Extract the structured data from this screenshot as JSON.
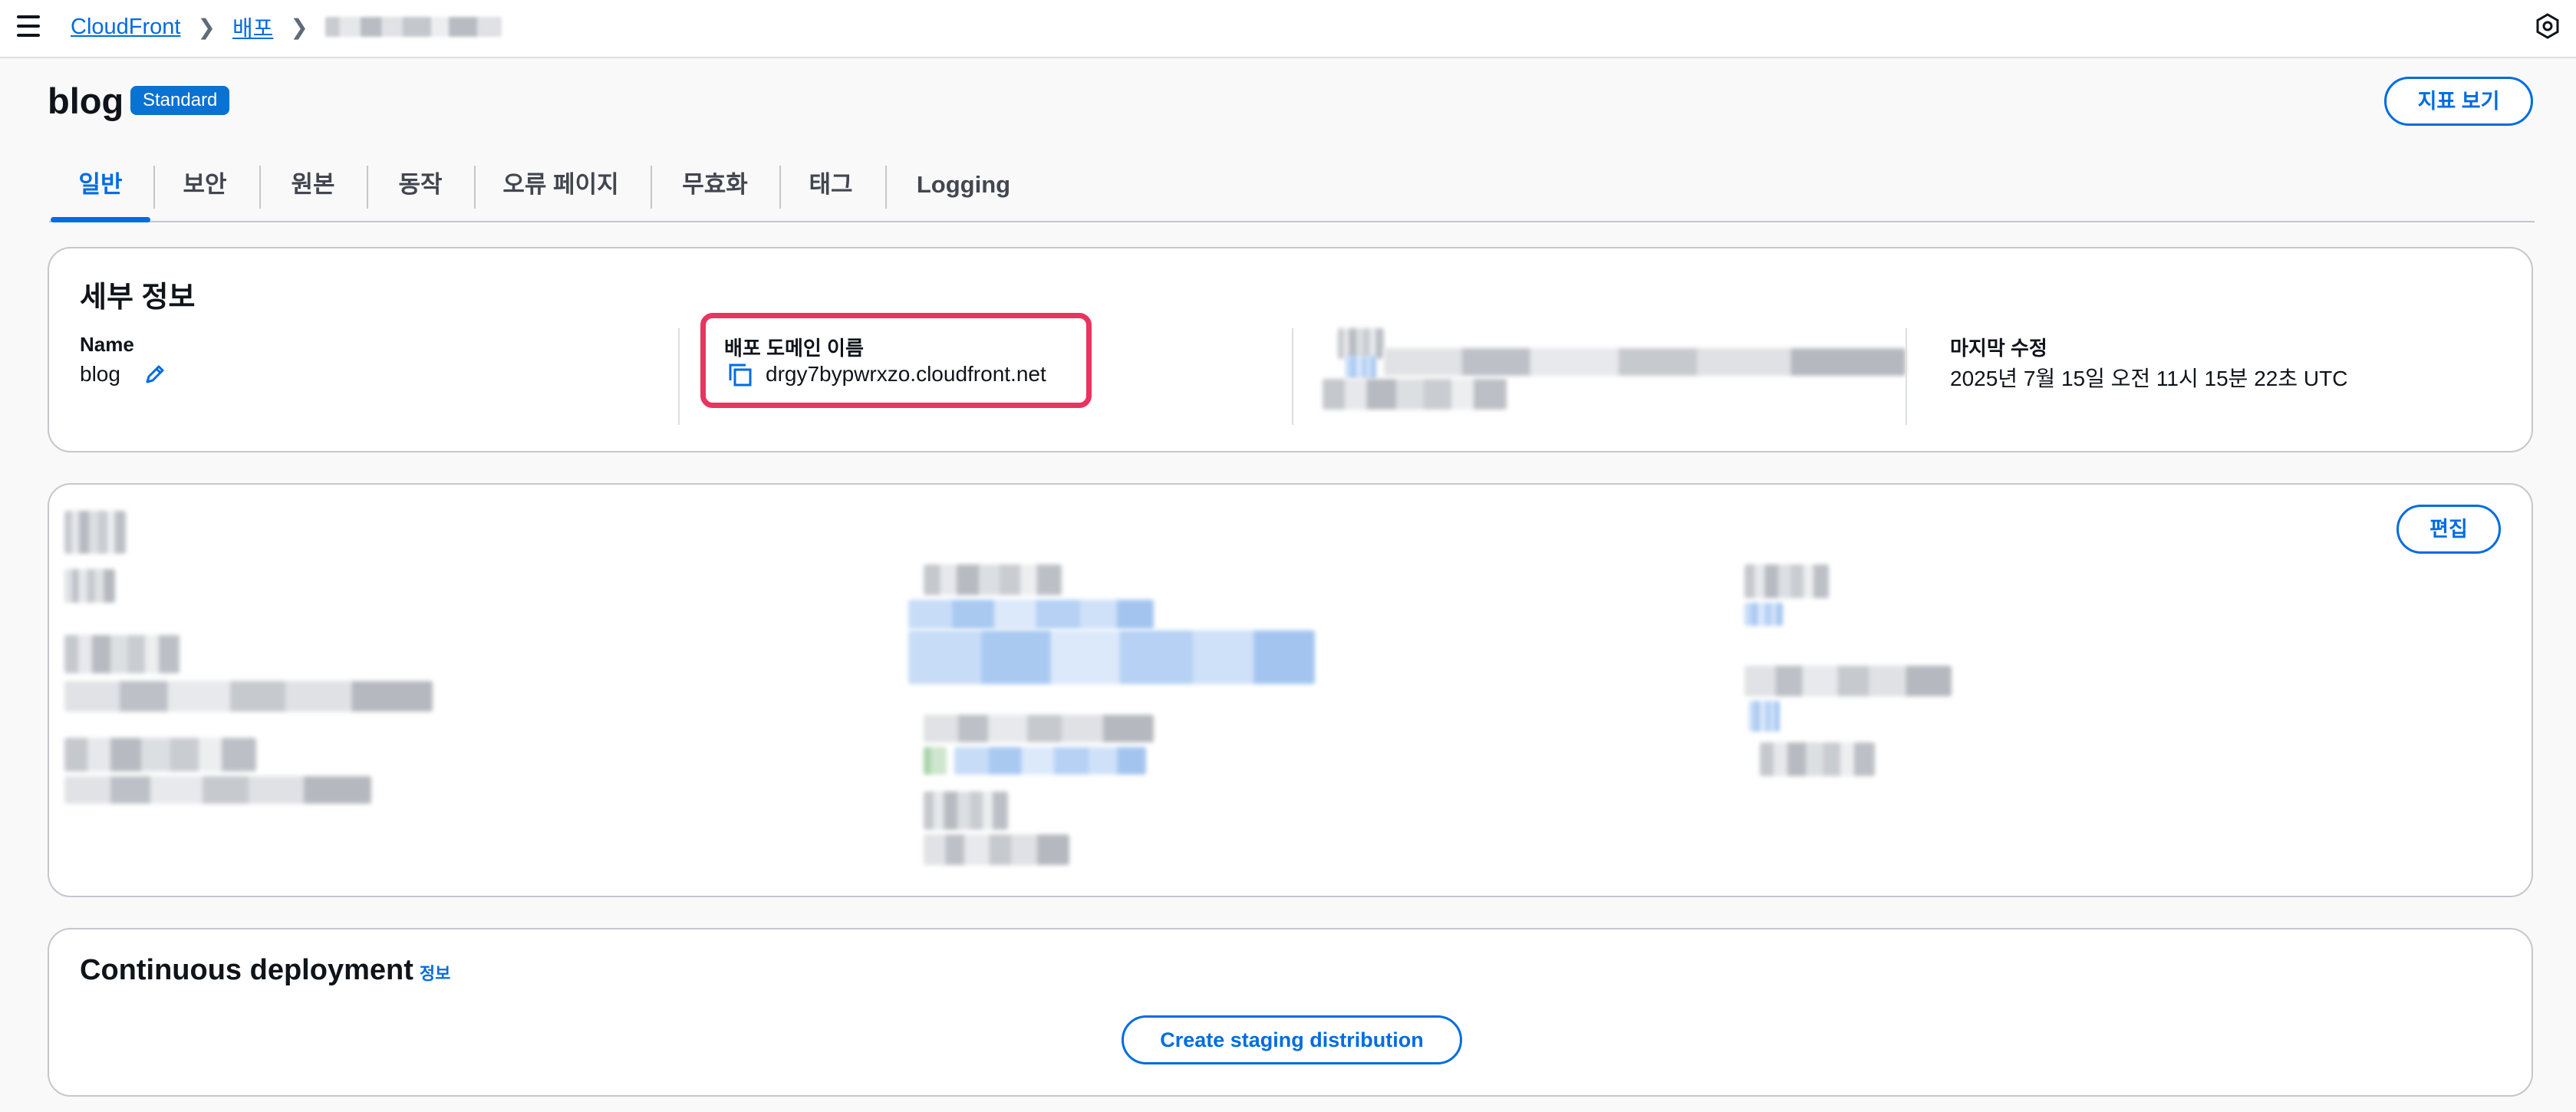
{
  "topbar": {
    "breadcrumbs": [
      {
        "label": "CloudFront"
      },
      {
        "label": "배포"
      }
    ]
  },
  "header": {
    "title": "blog",
    "badge": "Standard",
    "metrics_button": "지표 보기"
  },
  "tabs": [
    "일반",
    "보안",
    "원본",
    "동작",
    "오류 페이지",
    "무효화",
    "태그",
    "Logging"
  ],
  "details": {
    "heading": "세부 정보",
    "name_label": "Name",
    "name_value": "blog",
    "domain_label": "배포 도메인 이름",
    "domain_value": "drgy7bypwrxzo.cloudfront.net",
    "modified_label": "마지막 수정",
    "modified_value": "2025년 7월 15일 오전 11시 15분 22초 UTC"
  },
  "settings": {
    "edit_button": "편집"
  },
  "continuous": {
    "heading": "Continuous deployment",
    "info_link": "정보",
    "create_button": "Create staging distribution"
  },
  "colors": {
    "accent": "#006ce0",
    "badge": "#0972d3",
    "highlight": "#e8345f"
  }
}
